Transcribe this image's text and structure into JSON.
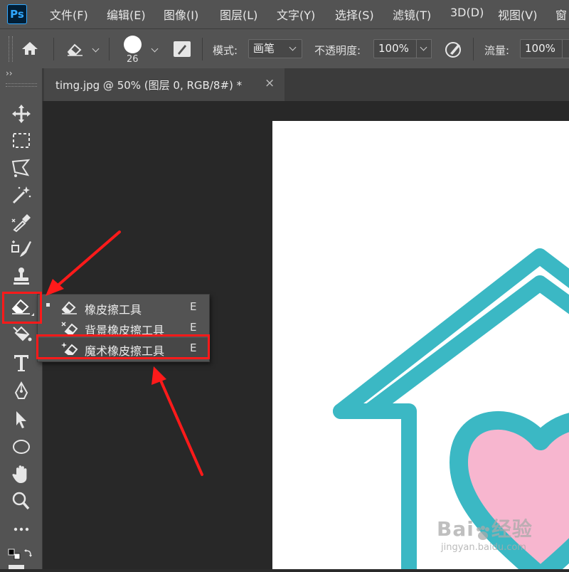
{
  "app": {
    "logo": "Ps",
    "accent": "#31a8ff"
  },
  "menu": [
    "文件(F)",
    "编辑(E)",
    "图像(I)",
    "图层(L)",
    "文字(Y)",
    "选择(S)",
    "滤镜(T)",
    "3D(D)",
    "视图(V)",
    "窗"
  ],
  "options": {
    "brush_size": "26",
    "mode_label": "模式:",
    "mode_value": "画笔",
    "opacity_label": "不透明度:",
    "opacity_value": "100%",
    "flow_label": "流量:",
    "flow_value": "100%"
  },
  "toolbar": {
    "collapse": "››"
  },
  "document_tab": {
    "title": "timg.jpg @ 50% (图层 0, RGB/8#) *",
    "close": "×"
  },
  "tools": [
    "move-icon",
    "marquee-icon",
    "lasso-icon",
    "magic-wand-icon",
    "eyedropper-icon",
    "healing-brush-icon",
    "stamp-icon",
    "eraser-icon",
    "paint-bucket-icon",
    "type-icon",
    "pen-icon",
    "selection-arrow-icon",
    "ellipse-icon",
    "hand-icon",
    "zoom-icon",
    "more-icon",
    "color-swatches-icon"
  ],
  "flyout": {
    "items": [
      {
        "label": "橡皮擦工具",
        "shortcut": "E",
        "icon": "eraser-icon",
        "active": true
      },
      {
        "label": "背景橡皮擦工具",
        "shortcut": "E",
        "icon": "background-eraser-icon",
        "active": false
      },
      {
        "label": "魔术橡皮擦工具",
        "shortcut": "E",
        "icon": "magic-eraser-icon",
        "active": false
      }
    ]
  },
  "artwork": {
    "house_color": "#3bb8c4",
    "heart_color": "#f7b6cf",
    "background": "#ffffff"
  },
  "annotation": {
    "color": "#ff1a1a"
  },
  "watermark": {
    "brand": "Bai",
    "brand2": "经验",
    "sub": "jingyan.baidu.com"
  }
}
